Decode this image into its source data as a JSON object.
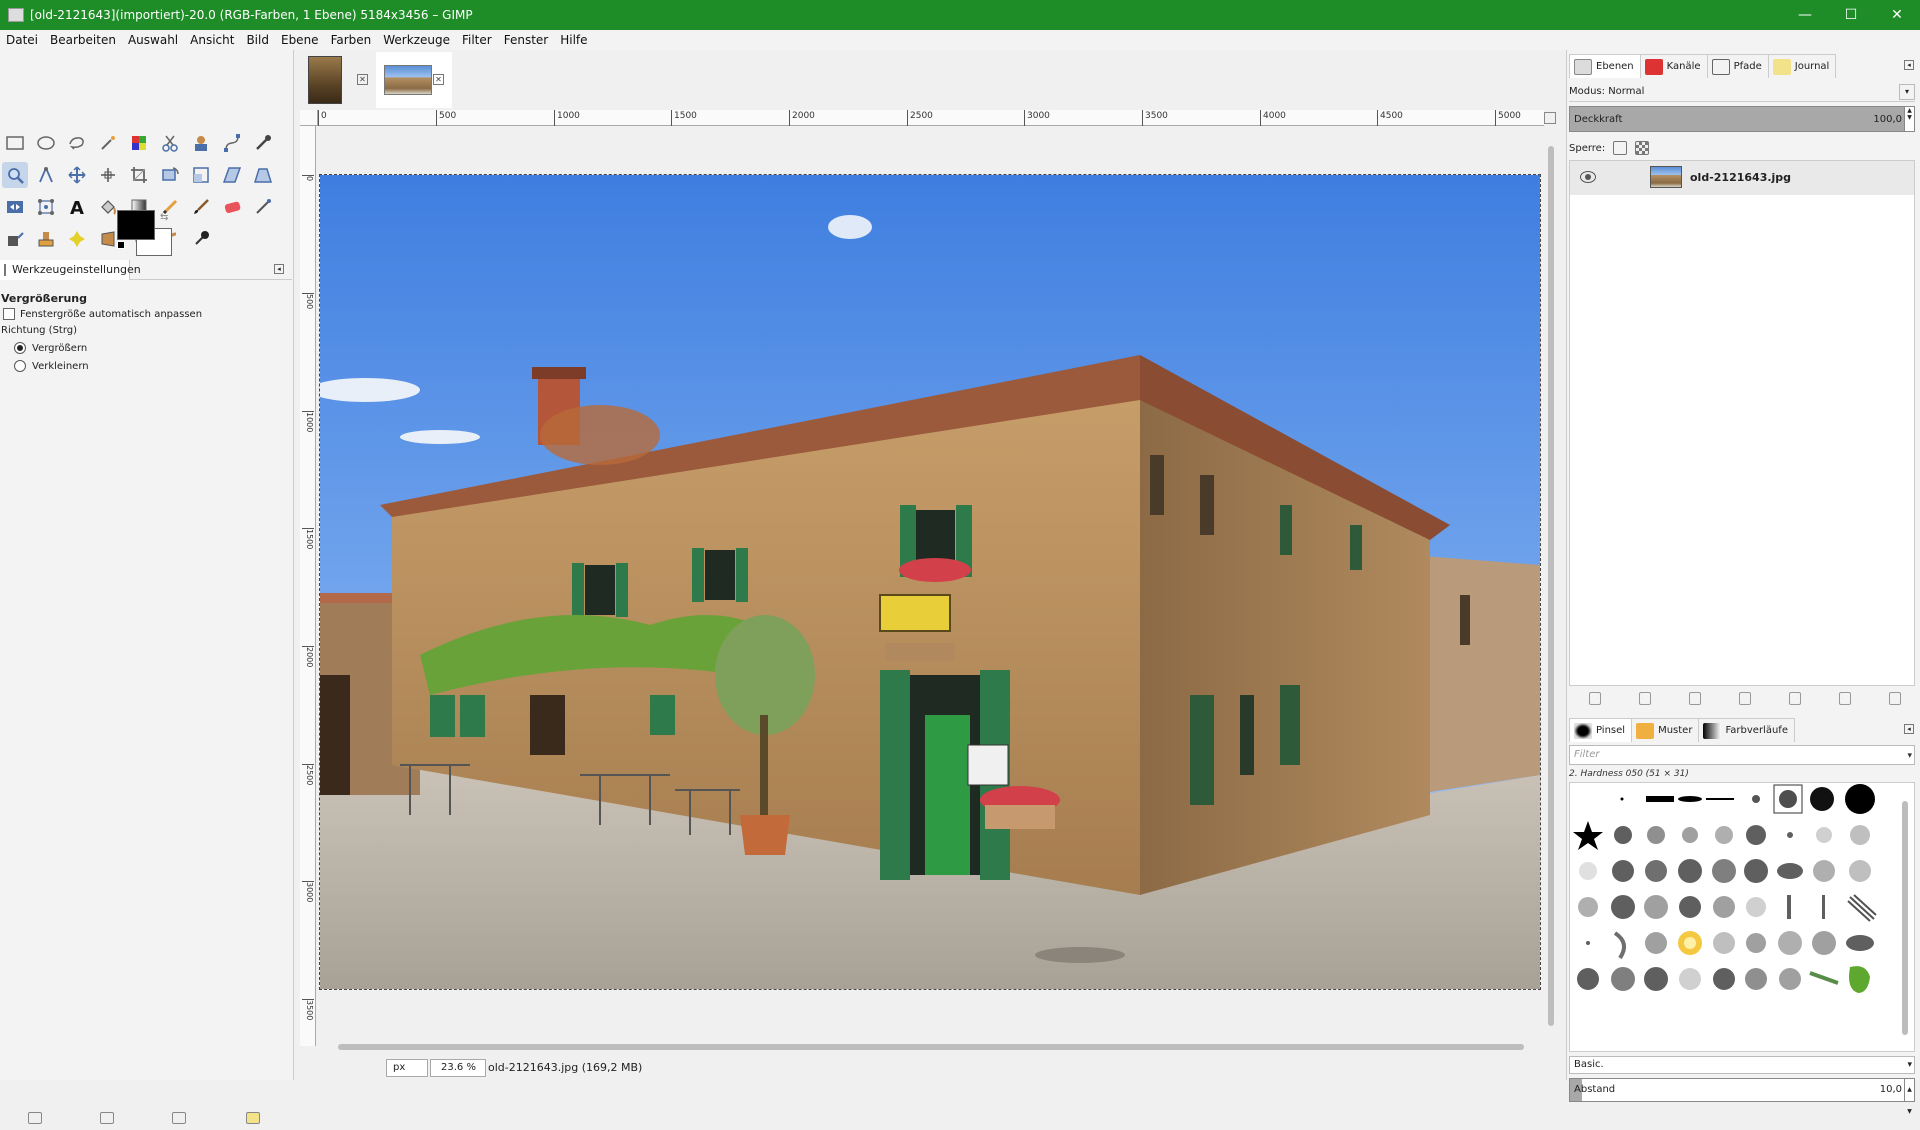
{
  "window": {
    "title": "[old-2121643](importiert)-20.0 (RGB-Farben, 1 Ebene) 5184x3456 – GIMP",
    "minimize": "—",
    "maximize": "☐",
    "close": "✕"
  },
  "menu": [
    "Datei",
    "Bearbeiten",
    "Auswahl",
    "Ansicht",
    "Bild",
    "Ebene",
    "Farben",
    "Werkzeuge",
    "Filter",
    "Fenster",
    "Hilfe"
  ],
  "tool_options": {
    "tab_label": "Werkzeugeinstellungen",
    "heading": "Vergrößerung",
    "auto_resize_label": "Fenstergröße automatisch anpassen",
    "direction_label": "Richtung (Strg)",
    "zoom_in_label": "Vergrößern",
    "zoom_out_label": "Verkleinern",
    "selected_direction": "Vergrößern"
  },
  "ruler": {
    "h_labels": [
      "0",
      "500",
      "1000",
      "1500",
      "2000",
      "2500",
      "3000",
      "3500",
      "4000",
      "4500",
      "5000"
    ],
    "v_labels": [
      "0",
      "500",
      "1000",
      "1500",
      "2000",
      "2500",
      "3000",
      "3500"
    ]
  },
  "status": {
    "unit": "px",
    "zoom": "23.6 %",
    "message": "old-2121643.jpg (169,2 MB)"
  },
  "layers_panel": {
    "tabs": [
      "Ebenen",
      "Kanäle",
      "Pfade",
      "Journal"
    ],
    "mode_label": "Modus: Normal",
    "opacity_label": "Deckkraft",
    "opacity_value": "100,0",
    "lock_label": "Sperre:",
    "layer_name": "old-2121643.jpg"
  },
  "brushes_panel": {
    "tabs": [
      "Pinsel",
      "Muster",
      "Farbverläufe"
    ],
    "filter_placeholder": "Filter",
    "selected_brush": "2. Hardness 050 (51 × 31)",
    "preset": "Basic.",
    "spacing_label": "Abstand",
    "spacing_value": "10,0"
  },
  "colors": {
    "titlebar": "#1e8c27",
    "foreground": "#000000",
    "background": "#ffffff"
  }
}
